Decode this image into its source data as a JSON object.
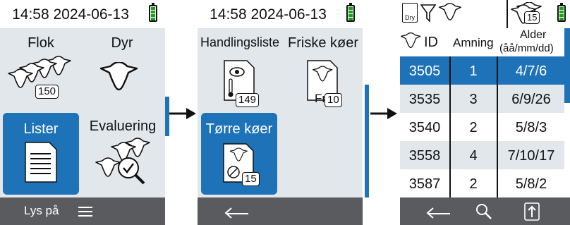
{
  "screen1": {
    "time": "14:58 2024-06-13",
    "tiles": [
      {
        "label": "Flok",
        "badge": "150"
      },
      {
        "label": "Dyr"
      },
      {
        "label": "Lister"
      },
      {
        "label": "Evaluering"
      }
    ],
    "bottom_label": "Lys på"
  },
  "screen2": {
    "time": "14:58 2024-06-13",
    "tiles": [
      {
        "label": "Handlingsliste",
        "badge": "149"
      },
      {
        "label": "Friske køer",
        "badge": "10",
        "icon_letter": "Fr"
      },
      {
        "label": "Tørre køer",
        "badge": "15"
      }
    ]
  },
  "screen3": {
    "status_badge": "15",
    "dry_label": "Dry",
    "headers": {
      "id": "ID",
      "amning": "Amning",
      "alder": "Alder",
      "alder_unit": "(åå/mm/dd)"
    },
    "rows": [
      {
        "id": "3505",
        "amning": "1",
        "alder": "4/7/6"
      },
      {
        "id": "3535",
        "amning": "3",
        "alder": "6/9/26"
      },
      {
        "id": "3540",
        "amning": "2",
        "alder": "5/8/3"
      },
      {
        "id": "3558",
        "amning": "4",
        "alder": "7/10/17"
      },
      {
        "id": "3587",
        "amning": "2",
        "alder": "5/8/2"
      }
    ]
  },
  "colors": {
    "accent": "#1d72b8",
    "panel": "#e2e7ec",
    "footer": "#5a5b5e",
    "battery": "#1aa31a"
  }
}
